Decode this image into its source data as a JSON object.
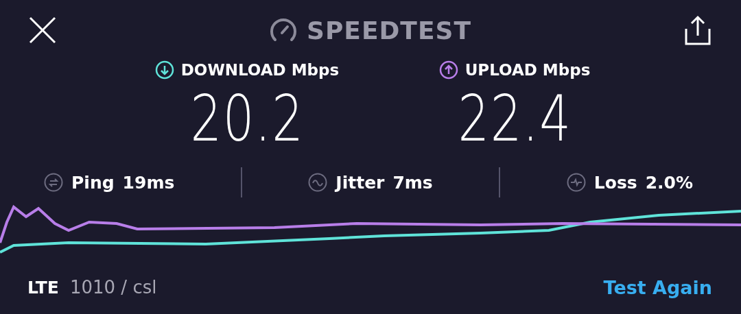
{
  "header": {
    "title": "SPEEDTEST"
  },
  "results": [
    {
      "kind": "download",
      "label": "DOWNLOAD Mbps",
      "value": "20.2"
    },
    {
      "kind": "upload",
      "label": "UPLOAD Mbps",
      "value": "22.4"
    }
  ],
  "stats": [
    {
      "kind": "ping",
      "label": "Ping",
      "value": "19ms"
    },
    {
      "kind": "jitter",
      "label": "Jitter",
      "value": "7ms"
    },
    {
      "kind": "loss",
      "label": "Loss",
      "value": "2.0%"
    }
  ],
  "footer": {
    "network": "LTE",
    "carrier": "1010 / csl",
    "action": "Test Again"
  }
}
